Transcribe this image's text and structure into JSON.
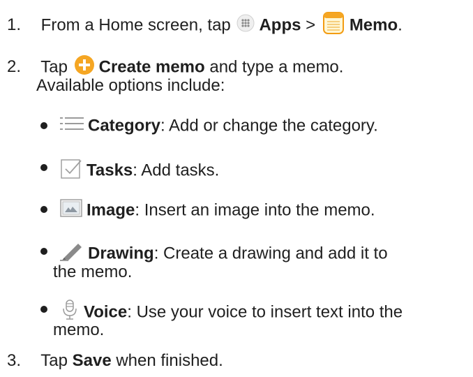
{
  "steps": [
    {
      "number": "1.",
      "text_before": "From a Home screen, tap",
      "apps_label": "Apps",
      "separator": ">",
      "memo_label": "Memo",
      "period": "."
    },
    {
      "number": "2.",
      "text_before": "Tap",
      "create_label": "Create memo",
      "text_after": "and type a memo.",
      "line2": "Available options include:"
    },
    {
      "number": "3.",
      "text_before": "Tap",
      "save_label": "Save",
      "text_after": "when finished."
    }
  ],
  "options": [
    {
      "icon": "category-list-icon",
      "label": "Category",
      "desc": ": Add or change the category."
    },
    {
      "icon": "tasks-checkbox-icon",
      "label": "Tasks",
      "desc": ": Add tasks."
    },
    {
      "icon": "image-icon",
      "label": "Image",
      "desc": ": Insert an image into the memo."
    },
    {
      "icon": "drawing-pencil-icon",
      "label": "Drawing",
      "desc": ": Create a drawing and add it to",
      "desc_line2": "the memo."
    },
    {
      "icon": "voice-microphone-icon",
      "label": "Voice",
      "desc": ": Use your voice to insert text into the",
      "desc_line2": "memo."
    }
  ]
}
